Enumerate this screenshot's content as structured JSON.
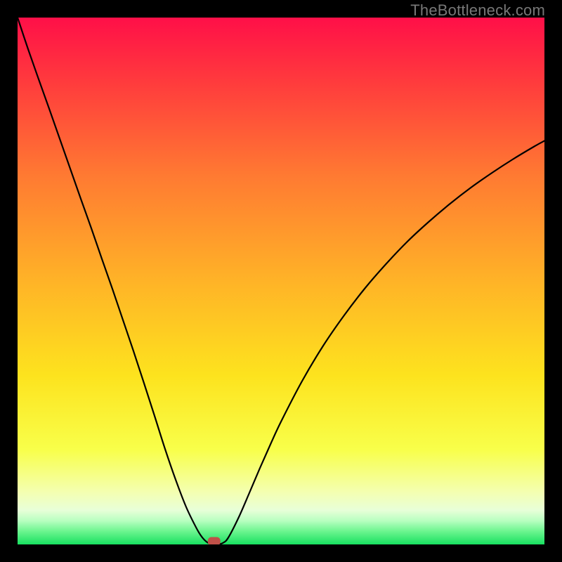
{
  "watermark": "TheBottleneck.com",
  "chart_data": {
    "type": "line",
    "title": "",
    "xlabel": "",
    "ylabel": "",
    "xlim": [
      0,
      100
    ],
    "ylim": [
      0,
      100
    ],
    "background": {
      "description": "vertical rainbow gradient from bright red at top through orange, yellow, pale-yellow, with thin pale-green band and bright green at very bottom",
      "stops": [
        {
          "offset": 0.0,
          "color": "#ff0f48"
        },
        {
          "offset": 0.12,
          "color": "#ff3a3d"
        },
        {
          "offset": 0.3,
          "color": "#ff7a32"
        },
        {
          "offset": 0.5,
          "color": "#ffb327"
        },
        {
          "offset": 0.68,
          "color": "#fde31e"
        },
        {
          "offset": 0.82,
          "color": "#f8ff4a"
        },
        {
          "offset": 0.9,
          "color": "#f4ffb0"
        },
        {
          "offset": 0.935,
          "color": "#e8ffd8"
        },
        {
          "offset": 0.955,
          "color": "#b8ffc0"
        },
        {
          "offset": 0.975,
          "color": "#6cf58f"
        },
        {
          "offset": 1.0,
          "color": "#18e060"
        }
      ]
    },
    "series": [
      {
        "name": "bottleneck-curve",
        "stroke": "#000000",
        "stroke_width": 2.2,
        "x": [
          0,
          2,
          4,
          6,
          8,
          10,
          12,
          14,
          16,
          18,
          20,
          22,
          24,
          26,
          28,
          30,
          32,
          34,
          35,
          36,
          37,
          38,
          39,
          40,
          42,
          44,
          46,
          48,
          50,
          54,
          58,
          62,
          66,
          70,
          74,
          78,
          82,
          86,
          90,
          94,
          98,
          100
        ],
        "y": [
          100,
          94,
          88.3,
          82.7,
          77.0,
          71.3,
          65.6,
          60.0,
          54.2,
          48.5,
          42.6,
          36.7,
          30.6,
          24.4,
          18.1,
          12.3,
          7.1,
          3.0,
          1.4,
          0.4,
          0.0,
          0.0,
          0.3,
          1.3,
          5.2,
          9.8,
          14.5,
          19.0,
          23.3,
          31.0,
          37.7,
          43.5,
          48.7,
          53.3,
          57.5,
          61.2,
          64.6,
          67.7,
          70.5,
          73.1,
          75.5,
          76.6
        ]
      }
    ],
    "markers": [
      {
        "name": "minimum-marker",
        "x": 37.3,
        "y": 0.6,
        "shape": "rounded-rect",
        "width_pct": 2.4,
        "height_pct": 1.6,
        "fill": "#c05048"
      }
    ]
  }
}
